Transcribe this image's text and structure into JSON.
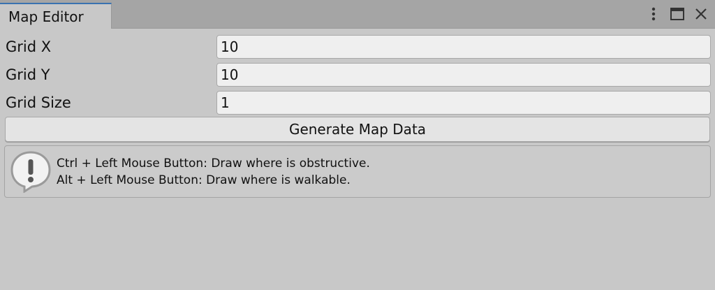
{
  "window": {
    "tab_title": "Map Editor",
    "menu_icon": "kebab-menu-icon",
    "maximize_icon": "maximize-icon",
    "close_icon": "close-icon"
  },
  "fields": [
    {
      "label": "Grid X",
      "value": "10"
    },
    {
      "label": "Grid Y",
      "value": "10"
    },
    {
      "label": "Grid Size",
      "value": "1"
    }
  ],
  "generate_button": {
    "label": "Generate Map Data"
  },
  "help": {
    "icon": "warning-icon",
    "lines": [
      "Ctrl + Left Mouse Button: Draw where is obstructive.",
      "Alt + Left Mouse Button: Draw where is walkable."
    ]
  },
  "colors": {
    "background": "#c8c8c8",
    "tab_accent": "#3a72b0",
    "input_bg": "#efefef"
  }
}
